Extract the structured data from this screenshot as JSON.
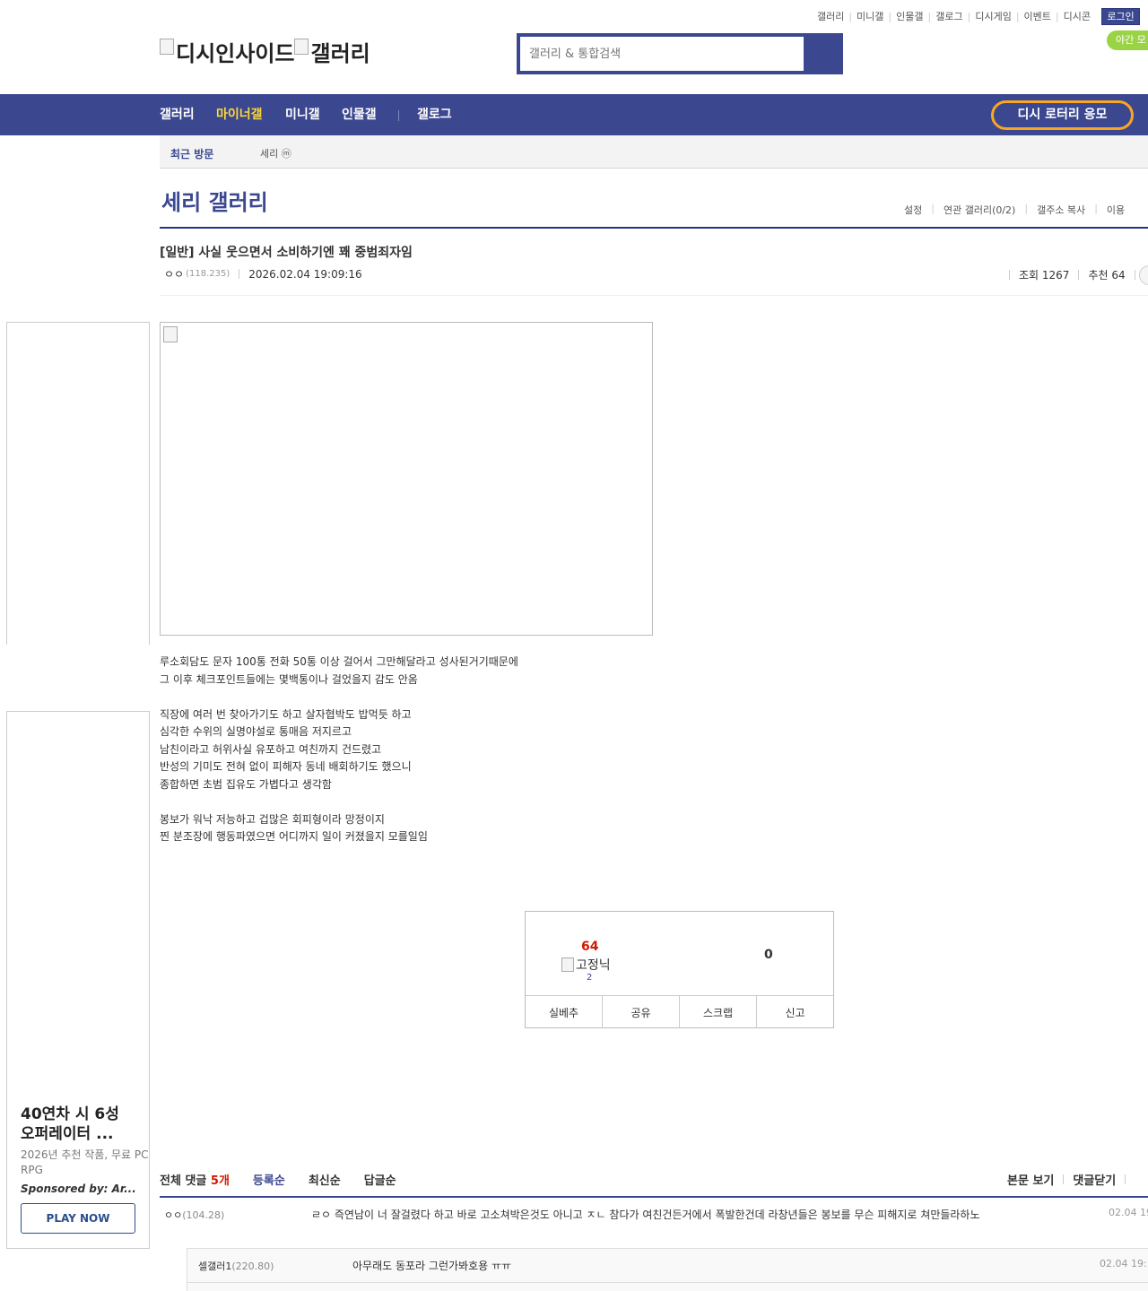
{
  "top_links": [
    "갤러리",
    "미니갤",
    "인물갤",
    "갤로그",
    "디시게임",
    "이벤트",
    "디시콘"
  ],
  "login_label": "로그인",
  "night_mode_label": "야간 모",
  "logo": {
    "site": "디시인사이드",
    "section": "갤러리"
  },
  "search": {
    "placeholder": "갤러리 & 통합검색"
  },
  "nav": {
    "items": [
      "갤러리",
      "마이너갤",
      "미니갤",
      "인물갤",
      "갤로그"
    ],
    "active": "마이너갤",
    "lottery_label": "디시 로터리 응모"
  },
  "recent": {
    "title": "최근 방문",
    "visited": "세리 ⓜ"
  },
  "gallery": {
    "title": "세리 갤러리",
    "tools": [
      "설정",
      "연관 갤러리(0/2)",
      "갤주소 복사",
      "이용"
    ]
  },
  "post": {
    "title": "[일반] 사실 웃으면서 소비하기엔 꽤 중범죄자임",
    "writer": "ㅇㅇ",
    "writer_ip": "(118.235)",
    "date": "2026.02.04 19:09:16",
    "views_label": "조회 1267",
    "recommend_label": "추천 64",
    "body_lines": [
      "루소회담도 문자 100통 전화 50통 이상 걸어서 그만해달라고 성사된거기때문에",
      "그 이후 체크포인트들에는 몇백통이나 걸었을지 감도 안옴",
      "",
      "직장에 여러 번 찾아가기도 하고 살자협박도 밥먹듯 하고",
      "심각한 수위의 실명야설로 통매음 저지르고",
      "남친이라고 허위사실 유포하고 여친까지 건드렸고",
      "반성의 기미도 전혀 없이 피해자 동네 배회하기도 했으니",
      "종합하면 초범 집유도 가볍다고 생각함",
      "",
      "봉보가 워낙 저능하고 겁많은 회피형이라 망정이지",
      "찐 분조장에 행동파였으면 어디까지 일이 커졌을지 모를일임"
    ]
  },
  "recommend": {
    "up_count": "64",
    "fixed_label": "고정닉",
    "fixed_count": "2",
    "down_count": "0",
    "buttons": [
      "실베추",
      "공유",
      "스크랩",
      "신고"
    ]
  },
  "ad": {
    "title": "40연차 시 6성 오퍼레이터 ...",
    "desc": "2026년 추천 작품, 무료 PC RPG",
    "sponsor": "Sponsored by: Ar...",
    "cta": "PLAY NOW"
  },
  "comments": {
    "total_label": "전체 댓글",
    "count": "5개",
    "sorts": [
      "등록순",
      "최신순",
      "답글순"
    ],
    "right_actions": [
      "본문 보기",
      "댓글닫기"
    ],
    "items": [
      {
        "writer": "ㅇㅇ",
        "ip": "(104.28)",
        "text": "ㄹㅇ 즉연남이 너 잘걸렸다 하고 바로 고소쳐박은것도 아니고 ㅈㄴ 참다가 여친건든거에서 폭발한건데 라창년들은 봉보를 무슨 피해지로 쳐만들라하노",
        "date": "02.04 19"
      }
    ],
    "reply": {
      "writer": "셀갤러1",
      "ip": "(220.80)",
      "text": "아무래도 동포라 그런가봐호용 ㅠㅠ",
      "date": "02.04 19:1"
    }
  },
  "colors": {
    "brand": "#3b4890",
    "accent": "#fdd738",
    "lottery_border": "#f9a623",
    "recommend_red": "#d31900",
    "night_green": "#9bd347"
  }
}
